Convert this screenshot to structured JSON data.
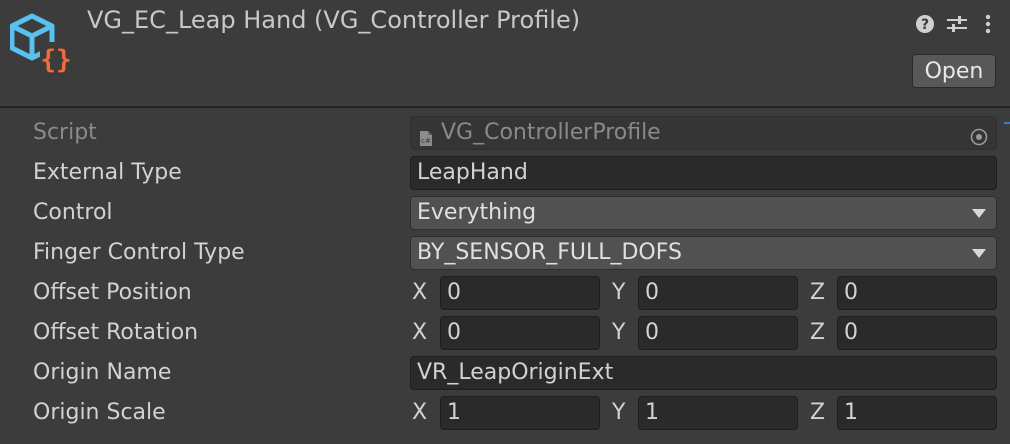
{
  "header": {
    "title": "VG_EC_Leap Hand (VG_Controller Profile)",
    "open_label": "Open"
  },
  "fields": {
    "script": {
      "label": "Script",
      "value": "VG_ControllerProfile"
    },
    "external_type": {
      "label": "External Type",
      "value": "LeapHand"
    },
    "control": {
      "label": "Control",
      "value": "Everything"
    },
    "finger_control_type": {
      "label": "Finger Control Type",
      "value": "BY_SENSOR_FULL_DOFS"
    },
    "offset_position": {
      "label": "Offset Position",
      "x": "0",
      "y": "0",
      "z": "0"
    },
    "offset_rotation": {
      "label": "Offset Rotation",
      "x": "0",
      "y": "0",
      "z": "0"
    },
    "origin_name": {
      "label": "Origin Name",
      "value": "VR_LeapOriginExt"
    },
    "origin_scale": {
      "label": "Origin Scale",
      "x": "1",
      "y": "1",
      "z": "1"
    }
  },
  "axes": {
    "x": "X",
    "y": "Y",
    "z": "Z"
  },
  "icons": {
    "asset": "scriptable-object-icon",
    "help": "help-icon",
    "presets": "sliders-icon",
    "menu": "kebab-menu-icon"
  },
  "colors": {
    "background": "#3c3c3c",
    "field": "#2a2a2a",
    "dropdown": "#515151",
    "asset_icon_blue": "#59c1f0",
    "asset_icon_orange": "#f26b3a"
  }
}
